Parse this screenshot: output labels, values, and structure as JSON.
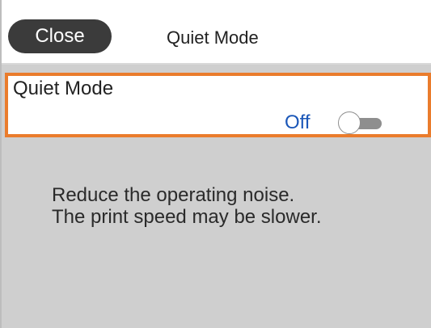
{
  "header": {
    "close_label": "Close",
    "title": "Quiet Mode"
  },
  "setting": {
    "label": "Quiet Mode",
    "value_text": "Off",
    "enabled": false
  },
  "description": {
    "line1": "Reduce the operating noise.",
    "line2": "The print speed may be slower."
  },
  "colors": {
    "accent_border": "#ea7c2c",
    "value_text": "#1b57b8",
    "close_button_bg": "#3b3b3b",
    "body_bg": "#cfcfcf"
  }
}
